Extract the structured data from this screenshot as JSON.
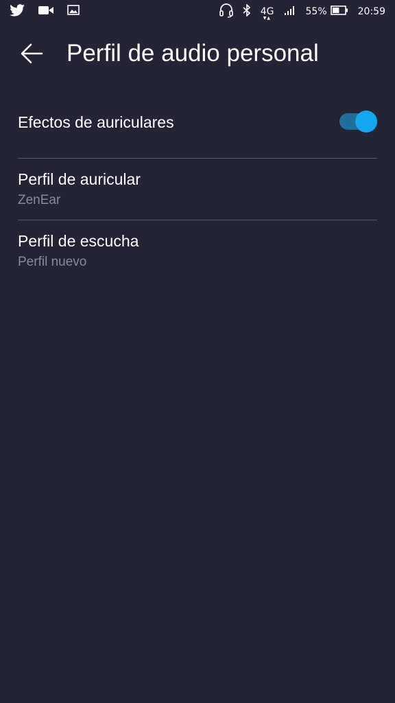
{
  "status_bar": {
    "notification_icons": [
      "twitter-icon",
      "video-camera-icon",
      "image-icon"
    ],
    "system_icons": [
      "headset-icon",
      "bluetooth-icon"
    ],
    "network": "4G",
    "battery_percent": "55%",
    "battery_level": 0.55,
    "time": "20:59"
  },
  "app_bar": {
    "back_icon": "arrow-back-icon",
    "title": "Perfil de audio personal"
  },
  "settings": {
    "headphone_effects": {
      "label": "Efectos de auriculares",
      "enabled": true
    },
    "headphone_profile": {
      "label": "Perfil de auricular",
      "value": "ZenEar"
    },
    "listening_profile": {
      "label": "Perfil de escucha",
      "value": "Perfil nuevo"
    }
  },
  "colors": {
    "background": "#242436",
    "accent": "#14a6ee",
    "accent_track": "#1e6f9c",
    "divider": "#5a5a6a",
    "secondary_text": "#8a8a96"
  }
}
